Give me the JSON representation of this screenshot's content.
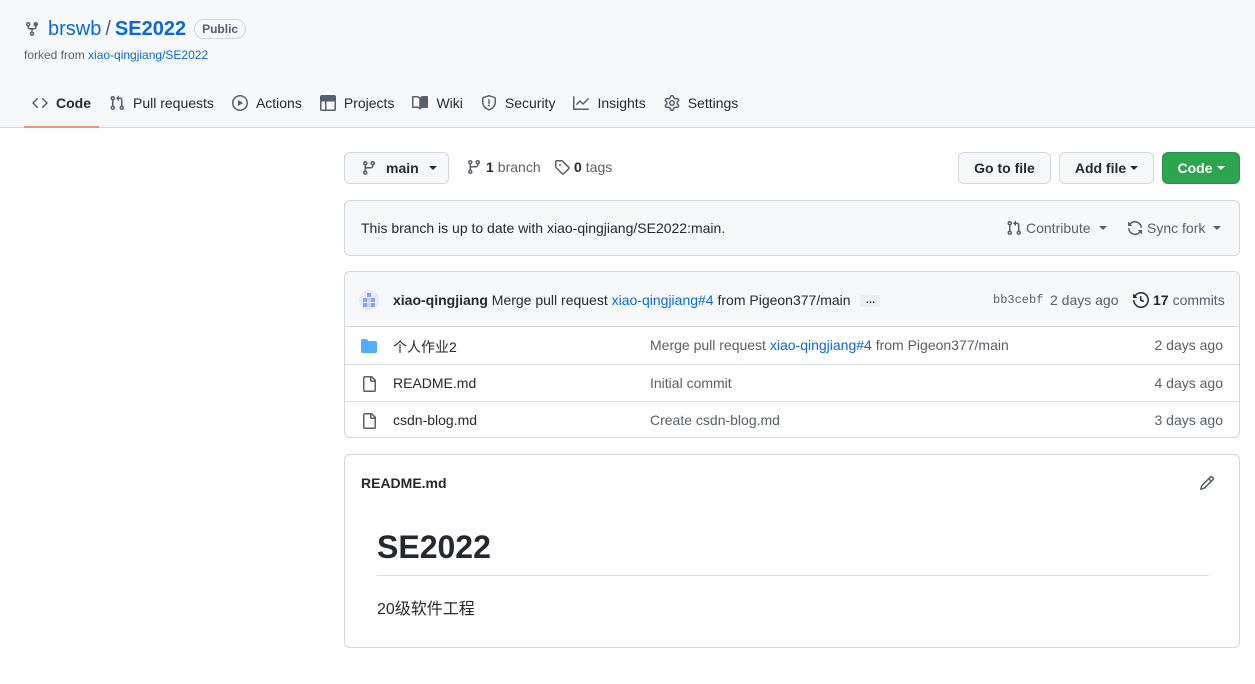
{
  "repo": {
    "owner": "brswb",
    "separator": "/",
    "name": "SE2022",
    "visibility": "Public",
    "forked_prefix": "forked from",
    "forked_source": "xiao-qingjiang/SE2022"
  },
  "tabs": [
    {
      "label": "Code",
      "icon": "code-icon",
      "selected": true
    },
    {
      "label": "Pull requests",
      "icon": "pull-request-icon"
    },
    {
      "label": "Actions",
      "icon": "play-icon"
    },
    {
      "label": "Projects",
      "icon": "table-icon"
    },
    {
      "label": "Wiki",
      "icon": "book-icon"
    },
    {
      "label": "Security",
      "icon": "shield-icon"
    },
    {
      "label": "Insights",
      "icon": "graph-icon"
    },
    {
      "label": "Settings",
      "icon": "gear-icon"
    }
  ],
  "branch_selector": {
    "label": "main"
  },
  "branches": {
    "count": "1",
    "label": "branch"
  },
  "tags": {
    "count": "0",
    "label": "tags"
  },
  "buttons": {
    "go_to_file": "Go to file",
    "add_file": "Add file",
    "code": "Code"
  },
  "sync": {
    "message": "This branch is up to date with xiao-qingjiang/SE2022:main.",
    "contribute": "Contribute",
    "sync_fork": "Sync fork"
  },
  "latest_commit": {
    "author": "xiao-qingjiang",
    "message_prefix": "Merge pull request",
    "pr_link": "xiao-qingjiang#4",
    "message_suffix": "from Pigeon377/main",
    "ellipsis": "…",
    "sha": "bb3cebf",
    "time": "2 days ago",
    "commit_count": "17",
    "commit_label": "commits"
  },
  "files": [
    {
      "name": "个人作业2",
      "type": "folder",
      "msg_prefix": "Merge pull request",
      "msg_link": "xiao-qingjiang#4",
      "msg_suffix": "from Pigeon377/main",
      "age": "2 days ago"
    },
    {
      "name": "README.md",
      "type": "file",
      "msg_prefix": "Initial commit",
      "msg_link": "",
      "msg_suffix": "",
      "age": "4 days ago"
    },
    {
      "name": "csdn-blog.md",
      "type": "file",
      "msg_prefix": "Create csdn-blog.md",
      "msg_link": "",
      "msg_suffix": "",
      "age": "3 days ago"
    }
  ],
  "readme": {
    "filename": "README.md",
    "heading": "SE2022",
    "body": "20级软件工程"
  },
  "colors": {
    "accent_blue": "#0969da",
    "green_button": "#2da44e",
    "tab_underline": "#fd8c73",
    "folder_blue": "#54aeff"
  }
}
